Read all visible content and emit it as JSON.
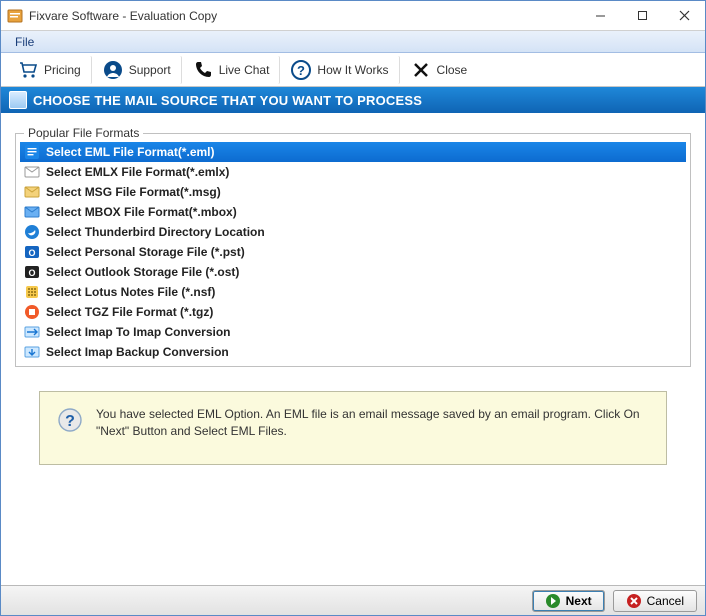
{
  "window": {
    "title": "Fixvare Software - Evaluation Copy"
  },
  "menu": {
    "file": "File"
  },
  "toolbar": {
    "pricing": "Pricing",
    "support": "Support",
    "live_chat": "Live Chat",
    "how_it_works": "How It Works",
    "close": "Close"
  },
  "section": {
    "header": "CHOOSE THE MAIL SOURCE THAT YOU WANT TO PROCESS"
  },
  "groupbox": {
    "legend": "Popular File Formats"
  },
  "formats": [
    {
      "label": "Select EML File Format(*.eml)",
      "selected": true,
      "icon": "eml"
    },
    {
      "label": "Select EMLX File Format(*.emlx)",
      "selected": false,
      "icon": "emlx"
    },
    {
      "label": "Select MSG File Format(*.msg)",
      "selected": false,
      "icon": "msg"
    },
    {
      "label": "Select MBOX File Format(*.mbox)",
      "selected": false,
      "icon": "mbox"
    },
    {
      "label": "Select Thunderbird Directory Location",
      "selected": false,
      "icon": "thunderbird"
    },
    {
      "label": "Select Personal Storage File (*.pst)",
      "selected": false,
      "icon": "pst"
    },
    {
      "label": "Select Outlook Storage File (*.ost)",
      "selected": false,
      "icon": "ost"
    },
    {
      "label": "Select Lotus Notes File (*.nsf)",
      "selected": false,
      "icon": "nsf"
    },
    {
      "label": "Select TGZ File Format (*.tgz)",
      "selected": false,
      "icon": "tgz"
    },
    {
      "label": "Select Imap To Imap Conversion",
      "selected": false,
      "icon": "imap"
    },
    {
      "label": "Select Imap Backup Conversion",
      "selected": false,
      "icon": "imap-backup"
    }
  ],
  "info": {
    "text": "You have selected EML Option. An EML file is an email message saved by an email program. Click On \"Next\" Button and Select EML Files."
  },
  "footer": {
    "next": "Next",
    "cancel": "Cancel"
  }
}
